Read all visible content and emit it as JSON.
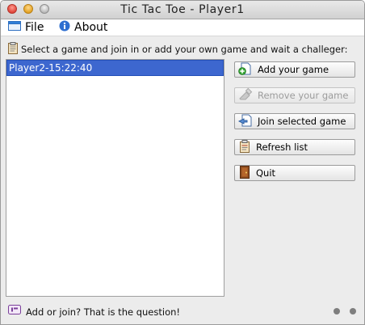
{
  "window": {
    "title": "Tic Tac Toe - Player1"
  },
  "menu": {
    "file": "File",
    "about": "About"
  },
  "instruction": "Select a game and join in or add your own game and wait a challeger:",
  "games": [
    {
      "label": "Player2-15:22:40",
      "selected": true
    }
  ],
  "buttons": {
    "add": "Add your game",
    "remove": "Remove your game",
    "join": "Join selected game",
    "refresh": "Refresh list",
    "quit": "Quit"
  },
  "status": "Add or join? That is the question!",
  "icons": {
    "file": "window-icon",
    "about": "info-icon",
    "instruction": "clipboard-icon",
    "add": "add-document-icon",
    "remove": "remove-icon",
    "join": "join-icon",
    "refresh": "clipboard-icon",
    "quit": "door-icon",
    "status": "speech-bubble-icon"
  },
  "colors": {
    "selection": "#3d67cf",
    "accent": "#2f7fd8"
  }
}
